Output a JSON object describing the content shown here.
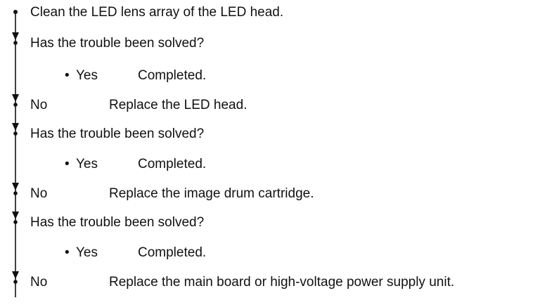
{
  "steps": [
    {
      "text": "Clean the LED lens array of the LED head."
    },
    {
      "text": "Has the trouble been solved?"
    },
    {
      "yes": "Yes",
      "result": "Completed."
    },
    {
      "no": "No",
      "action": "Replace the LED head."
    },
    {
      "text": "Has the trouble been solved?"
    },
    {
      "yes": "Yes",
      "result": "Completed."
    },
    {
      "no": "No",
      "action": "Replace the image drum cartridge."
    },
    {
      "text": "Has the trouble been solved?"
    },
    {
      "yes": "Yes",
      "result": "Completed."
    },
    {
      "no": "No",
      "action": "Replace the main board or high-voltage power supply unit."
    }
  ],
  "colors": {
    "text": "#111111",
    "line": "#111111"
  }
}
